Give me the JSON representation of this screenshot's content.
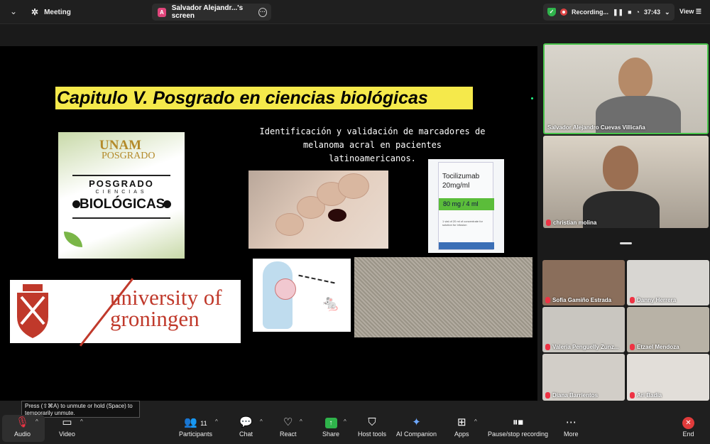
{
  "topbar": {
    "meeting_label": "Meeting",
    "share_tab_label": "Salvador Alejandr...'s screen",
    "share_avatar": "A",
    "recording_label": "Recording...",
    "timer": "37:43",
    "view_label": "View"
  },
  "slide": {
    "title": "Capitulo V.  Posgrado en ciencias biológicas",
    "subtitle": "Identificación y validación de marcadores de melanoma acral en pacientes latinoamericanos.",
    "unam_top": "UNAM",
    "unam_pos": "POSGRADO",
    "unam_p1": "POSGRADO",
    "unam_p2": "CIENCIAS",
    "unam_p3": "BIOLÓGICAS",
    "groningen": "university of groningen",
    "drug_name": "Tocilizumab",
    "drug_conc": "20mg/ml",
    "drug_band": "80 mg / 4 ml",
    "drug_small": "1 vial of 20 ml of concentrate for solution for infusion"
  },
  "tooltip": "Press (⇧⌘A) to unmute or hold (Space) to temporarily unmute.",
  "participants": [
    {
      "name": "Salvador Alejandro Cuevas Villicaña"
    },
    {
      "name": "christian molina"
    },
    {
      "name": "Sofía Gamiño Estrada"
    },
    {
      "name": "Danny Herrera"
    },
    {
      "name": "Valeria Penguelly Zunz..."
    },
    {
      "name": "Etzael Mendoza"
    },
    {
      "name": "Diana Barrientos"
    },
    {
      "name": "Ari Badía"
    }
  ],
  "toolbar": {
    "audio": "Audio",
    "video": "Video",
    "participants": "Participants",
    "participant_count": "11",
    "chat": "Chat",
    "react": "React",
    "share": "Share",
    "host_tools": "Host tools",
    "ai_companion": "AI Companion",
    "apps": "Apps",
    "pause_recording": "Pause/stop recording",
    "more": "More",
    "end": "End"
  },
  "colors": {
    "accent_green": "#48c34a",
    "end_red": "#e03b3b",
    "title_yellow": "#f5e94b",
    "groningen_red": "#c0392b"
  }
}
